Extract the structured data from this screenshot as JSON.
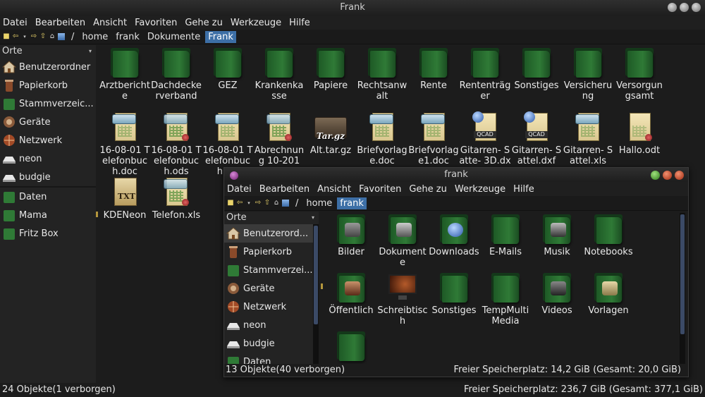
{
  "main": {
    "title": "Frank",
    "menu": [
      "Datei",
      "Bearbeiten",
      "Ansicht",
      "Favoriten",
      "Gehe zu",
      "Werkzeuge",
      "Hilfe"
    ],
    "path": [
      "/",
      "home",
      "frank",
      "Dokumente",
      "Frank"
    ],
    "sidebar": {
      "header": "Orte",
      "items": [
        {
          "label": "Benutzerordner",
          "icon": "home-icon"
        },
        {
          "label": "Papierkorb",
          "icon": "trash-icon"
        },
        {
          "label": "Stammverzeic...",
          "icon": "root-folder-icon"
        },
        {
          "label": "Geräte",
          "icon": "devices-icon"
        },
        {
          "label": "Netzwerk",
          "icon": "network-icon"
        },
        {
          "label": "neon",
          "icon": "drive-icon"
        },
        {
          "label": "budgie",
          "icon": "drive-icon"
        }
      ],
      "bookmarks": [
        {
          "label": "Daten"
        },
        {
          "label": "Mama"
        },
        {
          "label": "Fritz Box"
        }
      ]
    },
    "files": [
      {
        "label": "Arztbericht e",
        "type": "folder"
      },
      {
        "label": "Dachdecke rverband",
        "type": "folder"
      },
      {
        "label": "GEZ",
        "type": "folder"
      },
      {
        "label": "Krankenka sse",
        "type": "folder"
      },
      {
        "label": "Papiere",
        "type": "folder"
      },
      {
        "label": "Rechtsanw alt",
        "type": "folder"
      },
      {
        "label": "Rente",
        "type": "folder"
      },
      {
        "label": "Rententräg er",
        "type": "folder"
      },
      {
        "label": "Sonstiges",
        "type": "folder"
      },
      {
        "label": "Versicheru ng",
        "type": "folder"
      },
      {
        "label": "Versorgun gsamt",
        "type": "folder"
      },
      {
        "label": "16-08-01 Telefonbuc h.doc",
        "type": "doc"
      },
      {
        "label": "16-08-01 Telefonbuc h.ods",
        "type": "sheet"
      },
      {
        "label": "16-08-01 Telefonbuc h.xls",
        "type": "doc"
      },
      {
        "label": "Abrechnun g 10-2016...",
        "type": "sheet"
      },
      {
        "label": "Alt.tar.gz",
        "type": "tar"
      },
      {
        "label": "Briefvorlag e.doc",
        "type": "doc"
      },
      {
        "label": "Briefvorlag e1.doc",
        "type": "doc"
      },
      {
        "label": "Gitarren- Satte- 3D.dxf",
        "type": "qcad"
      },
      {
        "label": "Gitarren- Sattel.dxf",
        "type": "qcad"
      },
      {
        "label": "Gitarren- Sattel.xls",
        "type": "doc"
      },
      {
        "label": "Hallo.odt",
        "type": "odt"
      },
      {
        "label": "KDENeon",
        "type": "txt"
      },
      {
        "label": "Telefon.xls",
        "type": "sheet"
      }
    ],
    "status_left": "24 Objekte(1 verborgen)",
    "status_right": "Freier Speicherplatz: 236,7 GiB (Gesamt: 377,1 GiB)"
  },
  "second": {
    "title": "frank",
    "menu": [
      "Datei",
      "Bearbeiten",
      "Ansicht",
      "Favoriten",
      "Gehe zu",
      "Werkzeuge",
      "Hilfe"
    ],
    "path": [
      "/",
      "home",
      "frank"
    ],
    "sidebar": {
      "header": "Orte",
      "items": [
        {
          "label": "Benutzerord...",
          "icon": "home-icon"
        },
        {
          "label": "Papierkorb",
          "icon": "trash-icon"
        },
        {
          "label": "Stammverzei...",
          "icon": "root-folder-icon"
        },
        {
          "label": "Geräte",
          "icon": "devices-icon"
        },
        {
          "label": "Netzwerk",
          "icon": "network-icon"
        },
        {
          "label": "neon",
          "icon": "drive-icon"
        },
        {
          "label": "budgie",
          "icon": "drive-icon"
        },
        {
          "label": "Daten",
          "icon": "folder-icon"
        }
      ]
    },
    "files": [
      {
        "label": "Bilder",
        "type": "folder",
        "emblem": "camera"
      },
      {
        "label": "Dokument e",
        "type": "folder",
        "emblem": "typewriter"
      },
      {
        "label": "Downloads",
        "type": "folder",
        "emblem": "globe"
      },
      {
        "label": "E-Mails",
        "type": "folder",
        "emblem": ""
      },
      {
        "label": "Musik",
        "type": "folder",
        "emblem": "music"
      },
      {
        "label": "Notebooks",
        "type": "folder",
        "emblem": ""
      },
      {
        "label": "Öffentlich",
        "type": "folder",
        "emblem": "people"
      },
      {
        "label": "Schreibtisc h",
        "type": "desktop",
        "emblem": ""
      },
      {
        "label": "Sonstiges",
        "type": "folder",
        "emblem": ""
      },
      {
        "label": "TempMulti Media",
        "type": "folder",
        "emblem": ""
      },
      {
        "label": "Videos",
        "type": "folder",
        "emblem": "film"
      },
      {
        "label": "Vorlagen",
        "type": "folder",
        "emblem": "templates"
      },
      {
        "label": "",
        "type": "folder",
        "emblem": ""
      }
    ],
    "status_left": "13 Objekte(40 verborgen)",
    "status_right": "Freier Speicherplatz: 14,2 GiB (Gesamt: 20,0 GiB)"
  },
  "colors": {
    "accent": "#3d6fa6",
    "folder": "#2f7a36",
    "background": "#1c1c1c"
  }
}
